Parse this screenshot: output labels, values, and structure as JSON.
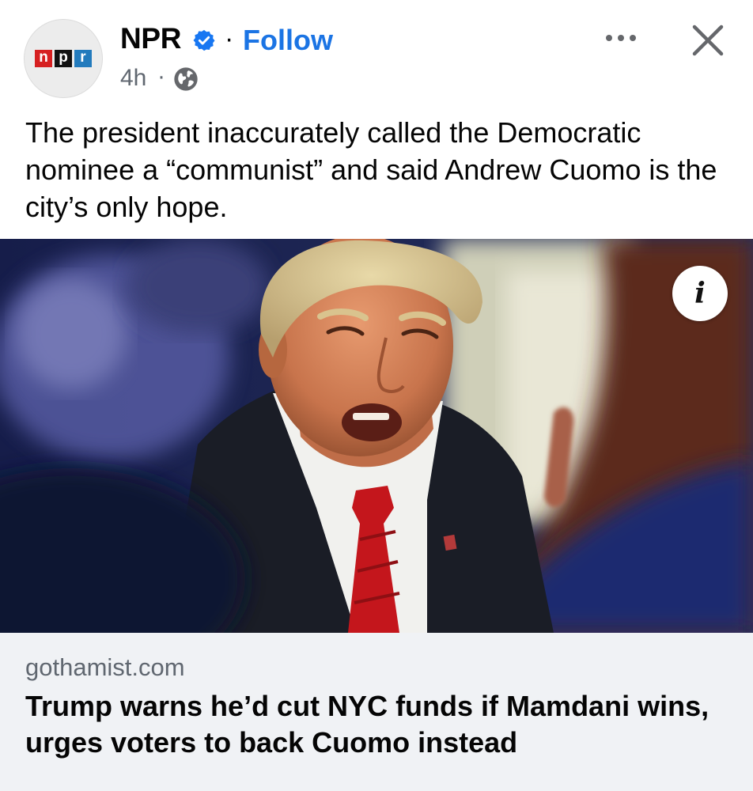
{
  "post": {
    "author": {
      "name": "NPR",
      "logo_letters": [
        "n",
        "p",
        "r"
      ],
      "verified": true,
      "verified_icon": "verified-badge-icon",
      "follow_separator": "·",
      "follow_label": "Follow"
    },
    "meta": {
      "time": "4h",
      "separator": "·",
      "audience_icon": "globe-icon"
    },
    "actions": {
      "more_icon": "more-options-icon",
      "close_icon": "close-icon"
    },
    "caption": "The president inaccurately called the Democratic nominee a “communist” and said Andrew Cuomo is the city’s only hope.",
    "photo": {
      "info_label": "i"
    },
    "link": {
      "domain": "gothamist.com",
      "headline": "Trump warns he’d cut NYC funds if Mamdani wins, urges voters to back Cuomo instead"
    }
  },
  "colors": {
    "follow_blue": "#1b74e4",
    "verified_blue": "#1877f2",
    "secondary_text": "#606770",
    "link_card_bg": "#f0f2f5",
    "npr_red": "#d62021",
    "npr_black": "#111111",
    "npr_blue": "#237bbd"
  }
}
